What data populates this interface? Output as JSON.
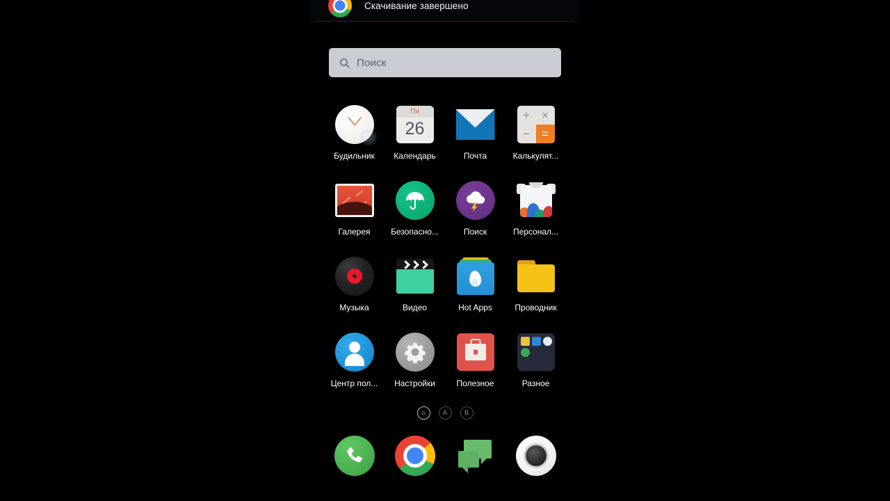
{
  "notification": {
    "icon": "chrome-icon",
    "text": "Скачивание завершено"
  },
  "search": {
    "icon": "search-icon",
    "placeholder": "Поиск",
    "value": ""
  },
  "app_grid": {
    "rows": 4,
    "columns": 4,
    "apps": [
      {
        "label": "Будильник",
        "icon": "alarm-clock-icon"
      },
      {
        "label": "Календарь",
        "icon": "calendar-icon",
        "weekday": "Пн",
        "day": "26"
      },
      {
        "label": "Почта",
        "icon": "mail-icon"
      },
      {
        "label": "Калькулят...",
        "icon": "calculator-icon",
        "keys": [
          "+",
          "×",
          "−",
          "="
        ]
      },
      {
        "label": "Галерея",
        "icon": "gallery-icon"
      },
      {
        "label": "Безопасно...",
        "icon": "security-umbrella-icon"
      },
      {
        "label": "Поиск",
        "icon": "weather-cloud-icon"
      },
      {
        "label": "Персонал...",
        "icon": "themes-tshirt-icon"
      },
      {
        "label": "Музыка",
        "icon": "music-vinyl-icon"
      },
      {
        "label": "Видео",
        "icon": "video-clapperboard-icon"
      },
      {
        "label": "Hot Apps",
        "icon": "hot-apps-flame-icon"
      },
      {
        "label": "Проводник",
        "icon": "file-folder-icon"
      },
      {
        "label": "Центр пол...",
        "icon": "user-center-icon"
      },
      {
        "label": "Настройки",
        "icon": "settings-gear-icon"
      },
      {
        "label": "Полезное",
        "icon": "toolbox-briefcase-icon"
      },
      {
        "label": "Разное",
        "icon": "misc-folder-icon"
      }
    ]
  },
  "pager": {
    "pages": [
      {
        "label": "⌂",
        "name": "home",
        "active": true
      },
      {
        "label": "A",
        "name": "page-a",
        "active": false
      },
      {
        "label": "B",
        "name": "page-b",
        "active": false
      }
    ]
  },
  "dock": {
    "items": [
      {
        "label": "Телефон",
        "icon": "phone-icon"
      },
      {
        "label": "Chrome",
        "icon": "chrome-icon"
      },
      {
        "label": "Сообщения",
        "icon": "messages-icon"
      },
      {
        "label": "Камера",
        "icon": "camera-icon"
      }
    ]
  },
  "colors": {
    "accent_orange": "#ec8022",
    "chrome_red": "#ea4335",
    "chrome_yellow": "#fbbc05",
    "chrome_green": "#34a853",
    "chrome_blue": "#4285f4",
    "search_bg": "#c9ccd2",
    "label_text": "#ffffff",
    "wallpaper_blue": "#16406d"
  }
}
